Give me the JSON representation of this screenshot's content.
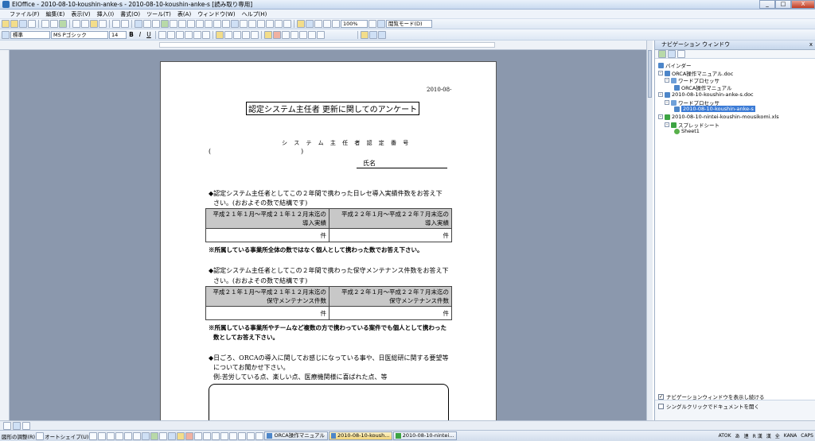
{
  "window": {
    "title": "EIOffice - 2010-08-10-koushin-anke-s - 2010-08-10-koushin-anke-s [読み取り専用]",
    "min": "_",
    "max": "□",
    "close": "X"
  },
  "menu": [
    "ファイル(F)",
    "編集(E)",
    "表示(V)",
    "挿入(I)",
    "書式(O)",
    "ツール(T)",
    "表(A)",
    "ウィンドウ(W)",
    "ヘルプ(H)"
  ],
  "toolbar1": {
    "zoom": "100%",
    "view_mode": "閲覧モード(D)"
  },
  "toolbar2": {
    "style": "標準",
    "font": "MS Pゴシック",
    "size": "14",
    "bold": "B",
    "italic": "I",
    "underline": "U"
  },
  "document": {
    "date": "2010-08-",
    "title": "認定システム主任者 更新に関してのアンケート",
    "cert_label": "シ ス テ ム 主 任 者 認 定 番 号",
    "paren_open": "(",
    "paren_close": ")",
    "name_label": "氏名",
    "q1_line1": "◆認定システム主任者としてこの２年間で携わった日レセ導入実績件数をお答え下",
    "q1_line2": "さい。(おおよその数で結構です)",
    "t1_h1_a": "平成２１年１月～平成２１年１２月末迄の",
    "t1_h1_b": "導入実績",
    "t1_h2_a": "平成２２年１月～平成２２年７月末迄の",
    "t1_h2_b": "導入実績",
    "t1_unit1": "件",
    "t1_unit2": "件",
    "note1": "※所属している事業所全体の数ではなく個人として携わった数でお答え下さい。",
    "q2_line1": "◆認定システム主任者としてこの２年間で携わった保守メンテナンス件数をお答え下",
    "q2_line2": "さい。(おおよその数で結構です)",
    "t2_h1_a": "平成２１年１月～平成２１年１２月末迄の",
    "t2_h1_b": "保守メンテナンス件数",
    "t2_h2_a": "平成２２年１月～平成２２年７月末迄の",
    "t2_h2_b": "保守メンテナンス件数",
    "t2_unit1": "件",
    "t2_unit2": "件",
    "note2_line1": "※所属している事業所やチームなど複数の方で携わっている案件でも個人として携わった",
    "note2_line2": "数としてお答え下さい。",
    "q3_line1": "◆日ごろ、ORCAの導入に関してお感じになっている事や、日医総研に関する要望等",
    "q3_line2": "についてお聞かせ下さい。",
    "q3_line3": "例:苦労している点、楽しい点、医療機関様に喜ばれた点、等"
  },
  "nav": {
    "title": "ナビゲーション ウィンドウ",
    "close": "x",
    "tree": [
      {
        "label": "バインダー"
      },
      {
        "label": "ORCA操作マニュアル.doc"
      },
      {
        "label": "ワードプロセッサ"
      },
      {
        "label": "ORCA操作マニュアル"
      },
      {
        "label": "2010-08-10-koushin-anke-s.doc"
      },
      {
        "label": "ワードプロセッサ"
      },
      {
        "label": "2010-08-10-koushin-anke-s"
      },
      {
        "label": "2010-08-10-nintei-koushin-mousikomi.xls"
      },
      {
        "label": "スプレッドシート"
      },
      {
        "label": "Sheet1"
      }
    ],
    "check1": "ナビゲーションウィンドウを表示し続ける",
    "check2": "シングルクリックでドキュメントを開く"
  },
  "drawbar": {
    "draw": "図形の調整(R)",
    "autoshape": "オートシェイプ(U)",
    "tasks": [
      "ORCA操作マニュアル",
      "2010-08-10-koush...",
      "2010-08-10-nintei..."
    ],
    "status": [
      "ATOK",
      "あ",
      "連",
      "R 漢",
      "漢",
      "全",
      "KANA",
      "CAPS"
    ]
  },
  "colors": {
    "accent": "#3b7bd6",
    "doc_bg": "#8b98ad",
    "table_header": "#c8c8c8"
  }
}
